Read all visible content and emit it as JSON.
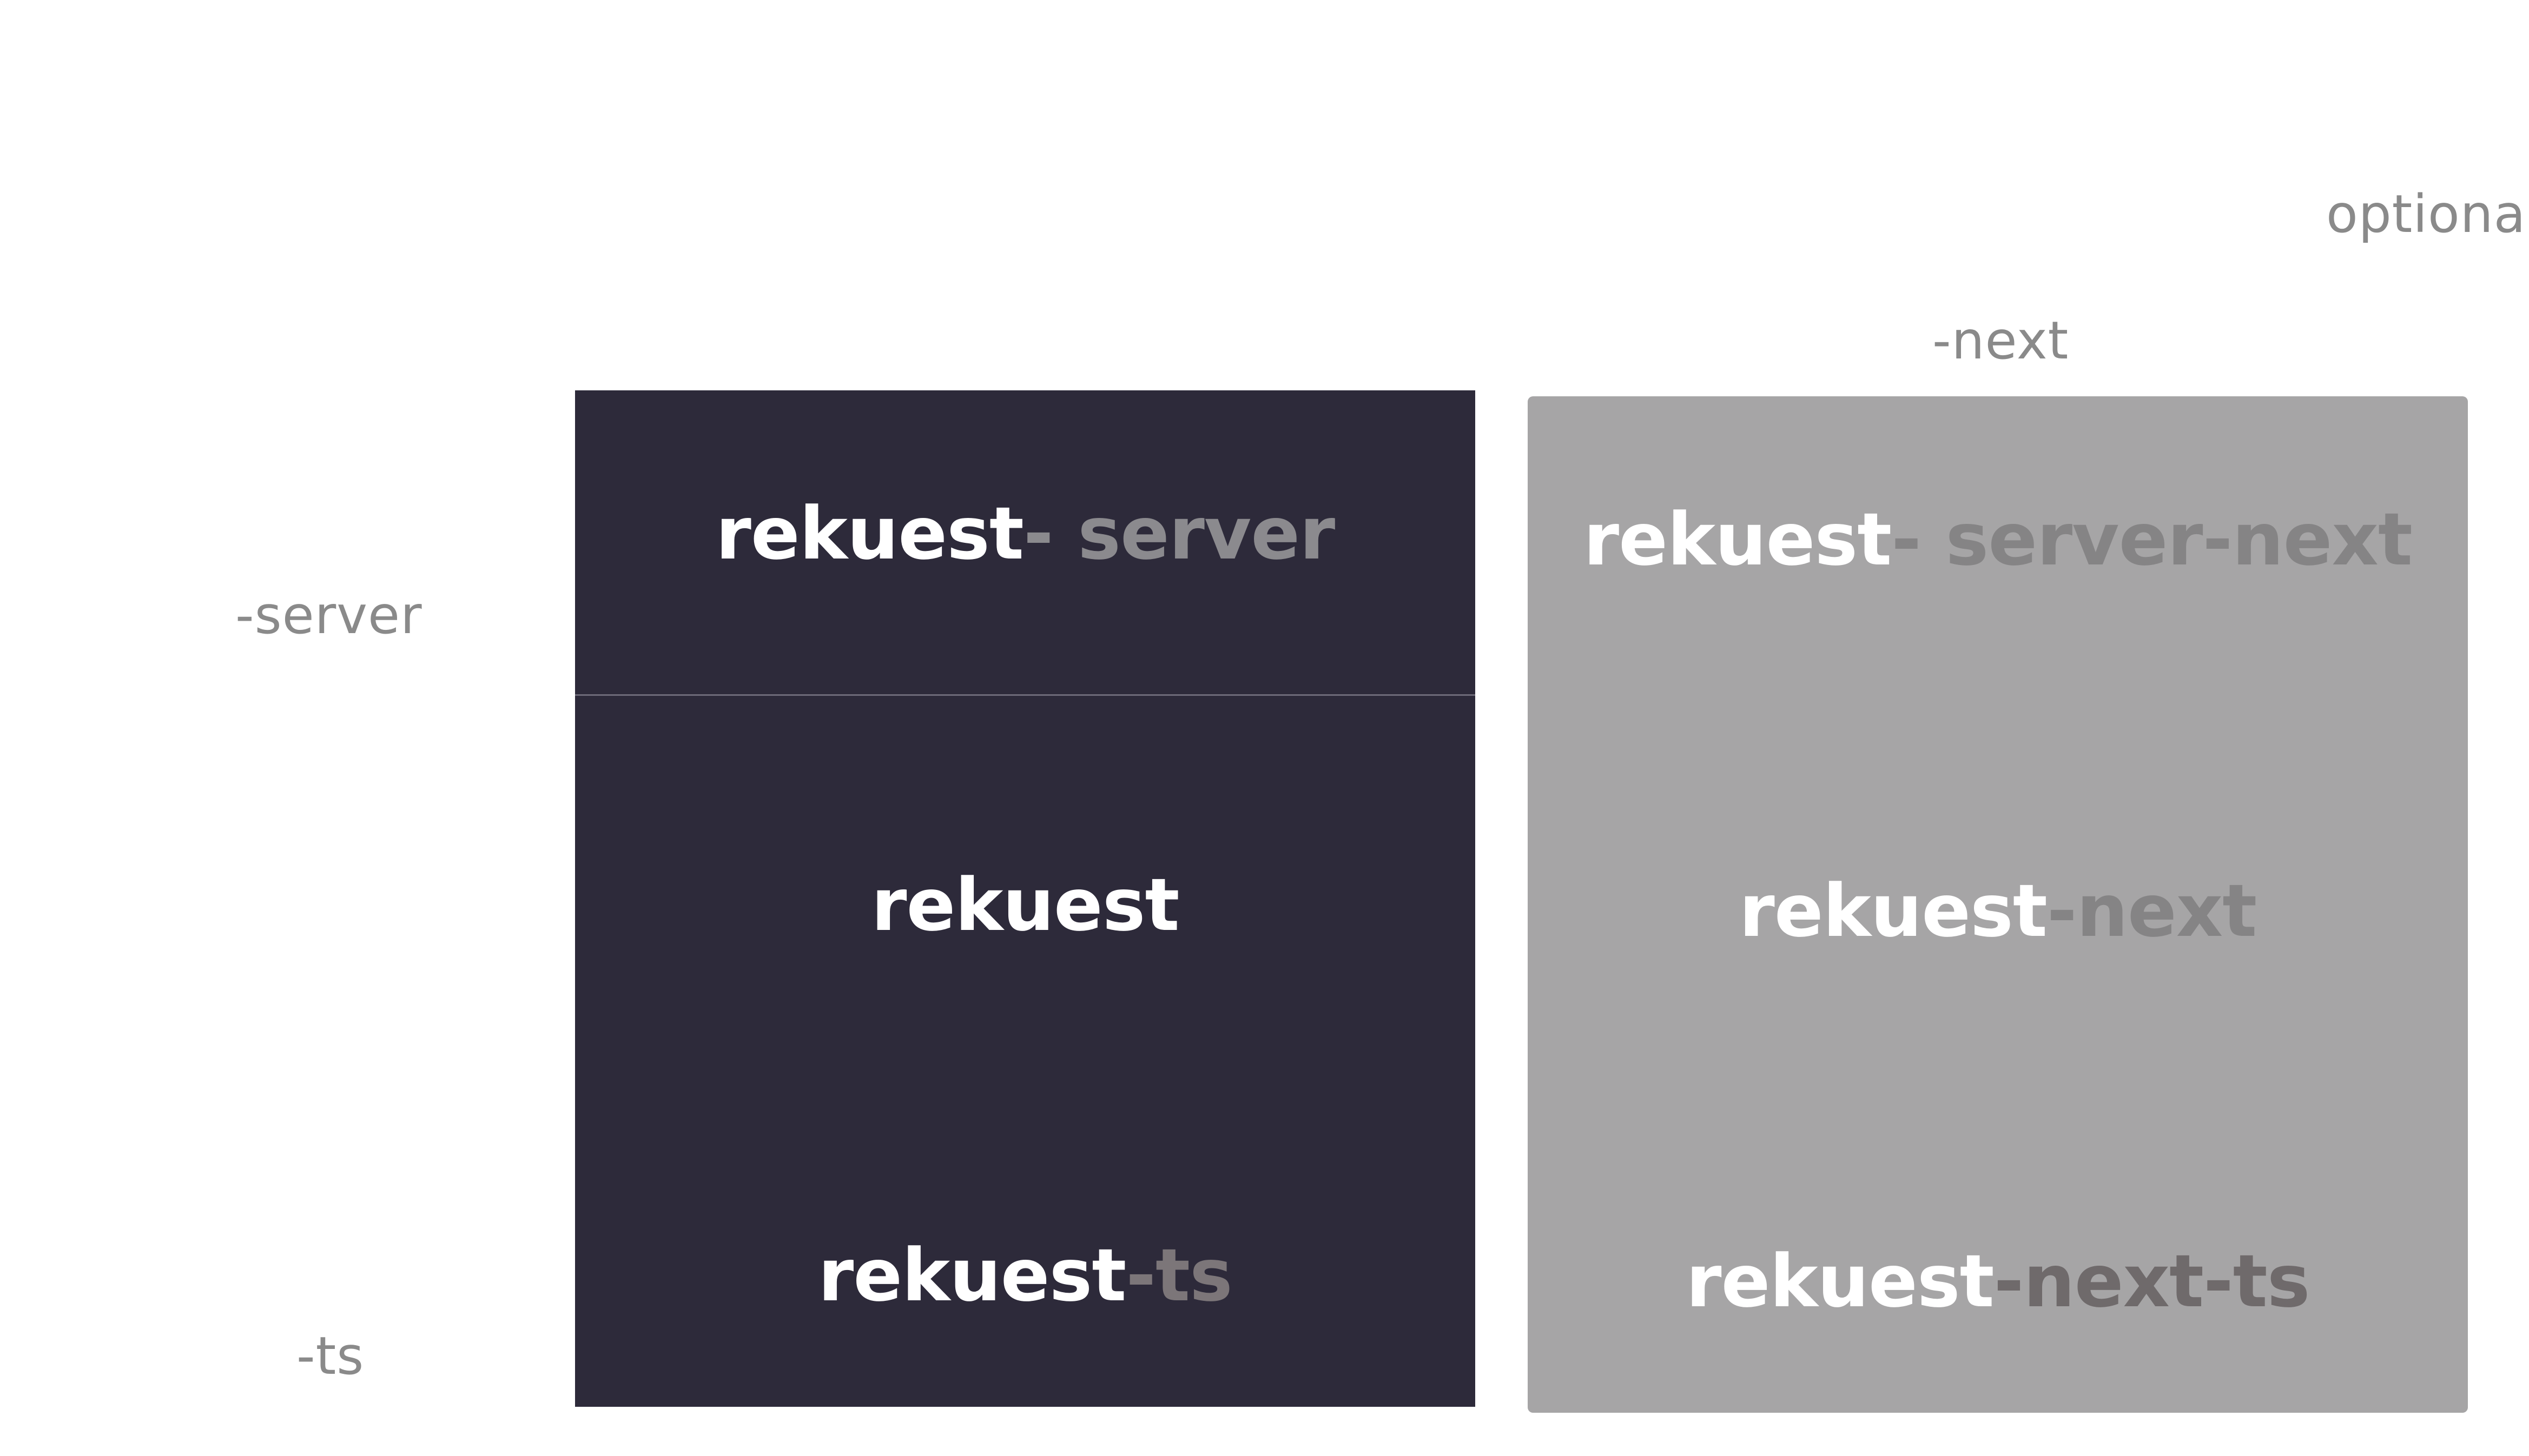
{
  "labels": {
    "optional": "optional",
    "next": "-next",
    "server": "-server",
    "ts": "-ts"
  },
  "core_panel": {
    "background_color": "#2d2a3a",
    "server": {
      "base": "rekuest",
      "suffix": "- server"
    },
    "main": {
      "base": "rekuest",
      "suffix": ""
    },
    "ts": {
      "base": "rekuest",
      "suffix": "-ts"
    }
  },
  "next_panel": {
    "background_color": "#a6a5a6",
    "server": {
      "base": "rekuest",
      "suffix": "- server-next"
    },
    "main": {
      "base": "rekuest",
      "suffix": "-next"
    },
    "ts": {
      "base": "rekuest",
      "suffix": "-next-ts"
    }
  }
}
